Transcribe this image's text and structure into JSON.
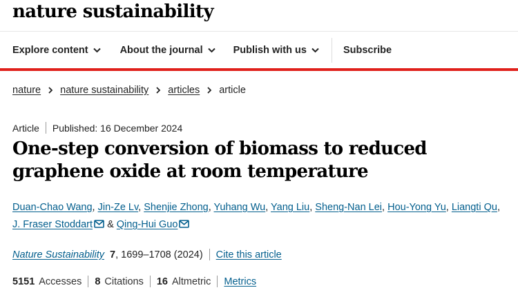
{
  "brand": "nature sustainability",
  "nav": [
    {
      "label": "Explore content"
    },
    {
      "label": "About the journal"
    },
    {
      "label": "Publish with us"
    },
    {
      "label": "Subscribe"
    }
  ],
  "breadcrumb": [
    "nature",
    "nature sustainability",
    "articles",
    "article"
  ],
  "article": {
    "type": "Article",
    "published": "Published: 16 December 2024",
    "title": "One-step conversion of biomass to reduced graphene oxide at room temperature",
    "authors": [
      "Duan-Chao Wang",
      "Jin-Ze Lv",
      "Shenjie Zhong",
      "Yuhang Wu",
      "Yang Liu",
      "Sheng-Nan Lei",
      "Hou-Yong Yu",
      "Liangti Qu",
      "J. Fraser Stoddart",
      "Qing-Hui Guo"
    ],
    "ampersand": "&",
    "journal": "Nature Sustainability",
    "volume": "7",
    "pages_year": ", 1699–1708 (2024)",
    "cite": "Cite this article"
  },
  "metrics": {
    "accesses_value": "5151",
    "accesses_label": "Accesses",
    "citations_value": "8",
    "citations_label": "Citations",
    "altmetric_value": "16",
    "altmetric_label": "Altmetric",
    "metrics_link": "Metrics"
  },
  "colors": {
    "accent_red": "#e0201b",
    "link_blue": "#025e8d"
  }
}
